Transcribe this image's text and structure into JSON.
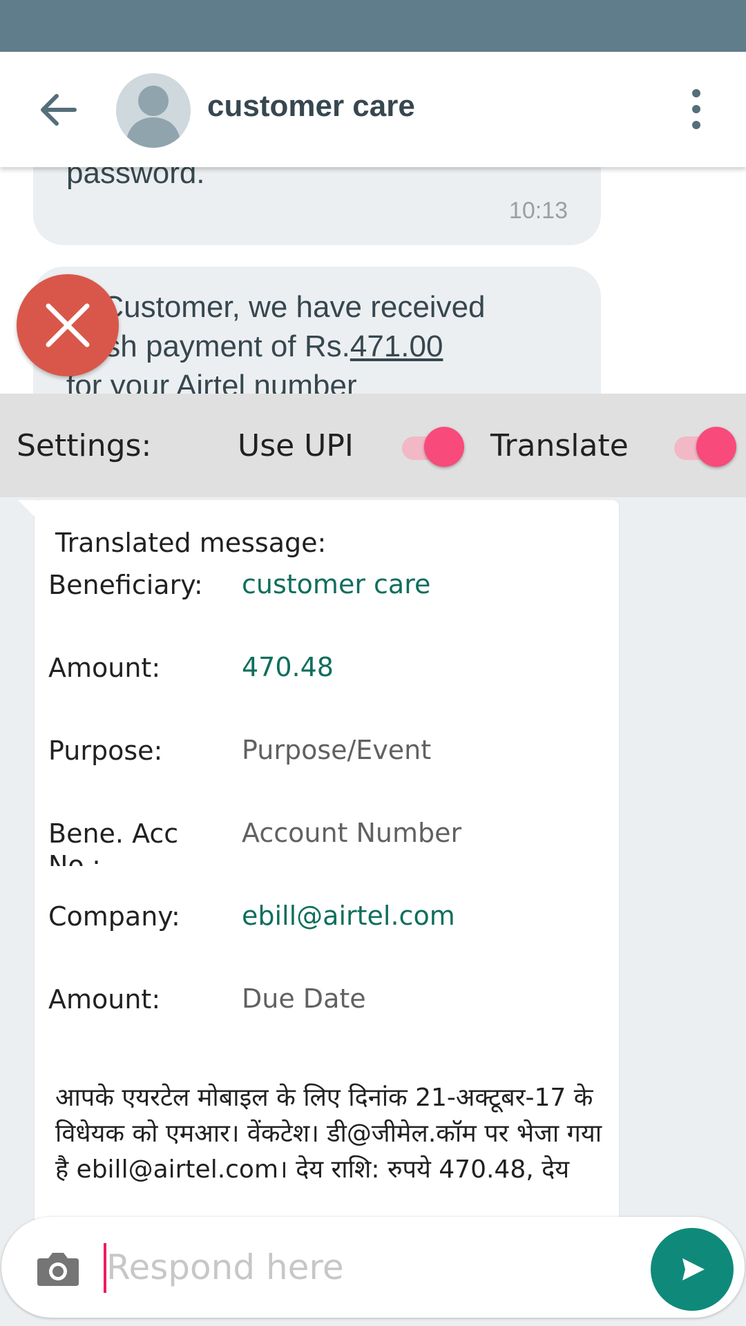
{
  "header": {
    "contact_name": "customer care"
  },
  "messages": [
    {
      "text": "password.",
      "time": "10:13"
    },
    {
      "text_start": "ar Customer, we have received",
      "text_line2_prefix": "Cash payment of Rs.",
      "amount": "471.00",
      "text_line3": "for your Airtel number"
    }
  ],
  "settings": {
    "label": "Settings:",
    "use_upi_label": "Use UPI",
    "use_upi_on": true,
    "translate_label": "Translate",
    "translate_on": true
  },
  "translated": {
    "title": "Translated message:",
    "rows": [
      {
        "label": "Beneficiary:",
        "value": "customer care"
      },
      {
        "label": "Amount:",
        "value": "470.48"
      },
      {
        "label": "Purpose:",
        "value": "Purpose/Event"
      },
      {
        "label": "Bene. Acc No.:",
        "value": "Account Number"
      },
      {
        "label": "Company:",
        "value": "ebill@airtel.com"
      },
      {
        "label": "Amount:",
        "value": "Due Date"
      }
    ],
    "hindi_text": "आपके एयरटेल मोबाइल के लिए दिनांक 21-अक्टूबर-17 के विधेयक को एमआर। वेंकटेश। डी@जीमेल.कॉम पर भेजा गया है ebill@airtel.com। देय राशि: रुपये 470.48, देय"
  },
  "composer": {
    "placeholder": "Respond here"
  },
  "colors": {
    "status_bar": "#607d8b",
    "accent_teal": "#0f8a7a",
    "toggle_pink": "#f94a7c",
    "close_red": "#d9574a"
  },
  "icons": [
    "back-arrow-icon",
    "avatar-icon",
    "more-vertical-icon",
    "close-icon",
    "camera-icon",
    "send-icon"
  ]
}
